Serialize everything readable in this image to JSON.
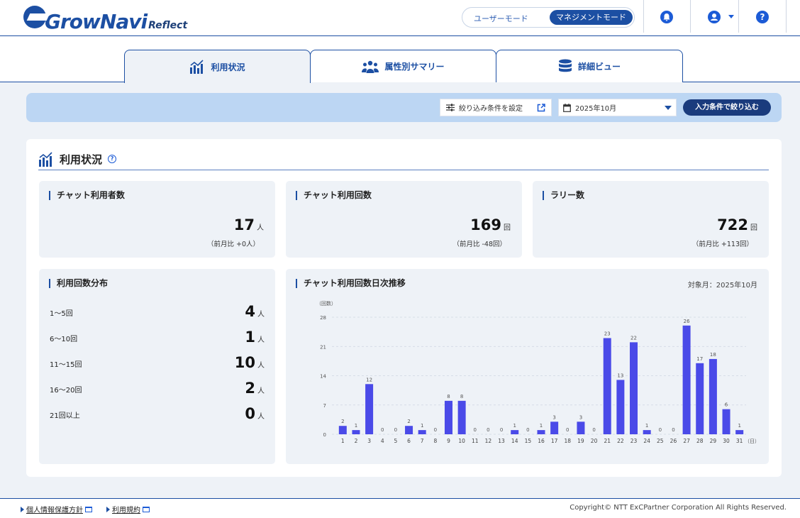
{
  "header": {
    "logo_main": "GrowNavi",
    "logo_sub": "Reflect",
    "mode_user": "ユーザーモード",
    "mode_management": "マネジメントモード",
    "icons": [
      "bell-icon",
      "user-icon",
      "help-icon"
    ]
  },
  "tabs": [
    {
      "label": "利用状況",
      "icon": "chart-icon",
      "active": true
    },
    {
      "label": "属性別サマリー",
      "icon": "users-icon",
      "active": false
    },
    {
      "label": "詳細ビュー",
      "icon": "database-icon",
      "active": false
    }
  ],
  "filter": {
    "condition_label": "絞り込み条件を設定",
    "month_value": "2025年10月",
    "apply_label": "入力条件で絞り込む"
  },
  "section": {
    "title": "利用状況"
  },
  "stats": [
    {
      "title": "チャット利用者数",
      "value": "17",
      "unit": "人",
      "sub": "（前月比 +0人）"
    },
    {
      "title": "チャット利用回数",
      "value": "169",
      "unit": "回",
      "sub": "（前月比 -48回）"
    },
    {
      "title": "ラリー数",
      "value": "722",
      "unit": "回",
      "sub": "（前月比 +113回）"
    }
  ],
  "distribution": {
    "title": "利用回数分布",
    "rows": [
      {
        "label": "1〜5回",
        "value": "4",
        "unit": "人"
      },
      {
        "label": "6〜10回",
        "value": "1",
        "unit": "人"
      },
      {
        "label": "11〜15回",
        "value": "10",
        "unit": "人"
      },
      {
        "label": "16〜20回",
        "value": "2",
        "unit": "人"
      },
      {
        "label": "21回以上",
        "value": "0",
        "unit": "人"
      }
    ]
  },
  "chart_panel": {
    "title": "チャット利用回数日次推移",
    "target_month": "対象月：2025年10月"
  },
  "chart_data": {
    "type": "bar",
    "ylabel": "（回数）",
    "xlabel": "（日）",
    "ylim": [
      0,
      28
    ],
    "yticks": [
      0,
      7,
      14,
      21,
      28
    ],
    "grid": true,
    "color": "#4a4ae8",
    "categories": [
      "1",
      "2",
      "3",
      "4",
      "5",
      "6",
      "7",
      "8",
      "9",
      "10",
      "11",
      "12",
      "13",
      "14",
      "15",
      "16",
      "17",
      "18",
      "19",
      "20",
      "21",
      "22",
      "23",
      "24",
      "25",
      "26",
      "27",
      "28",
      "29",
      "30",
      "31"
    ],
    "values": [
      2,
      1,
      12,
      0,
      0,
      2,
      1,
      0,
      8,
      8,
      0,
      0,
      0,
      1,
      0,
      1,
      3,
      0,
      3,
      0,
      23,
      13,
      22,
      1,
      0,
      0,
      26,
      17,
      18,
      6,
      1
    ]
  },
  "footer": {
    "privacy": "個人情報保護方針",
    "terms": "利用規約",
    "copyright": "Copyright© NTT ExCPartner Corporation All Rights Reserved."
  }
}
